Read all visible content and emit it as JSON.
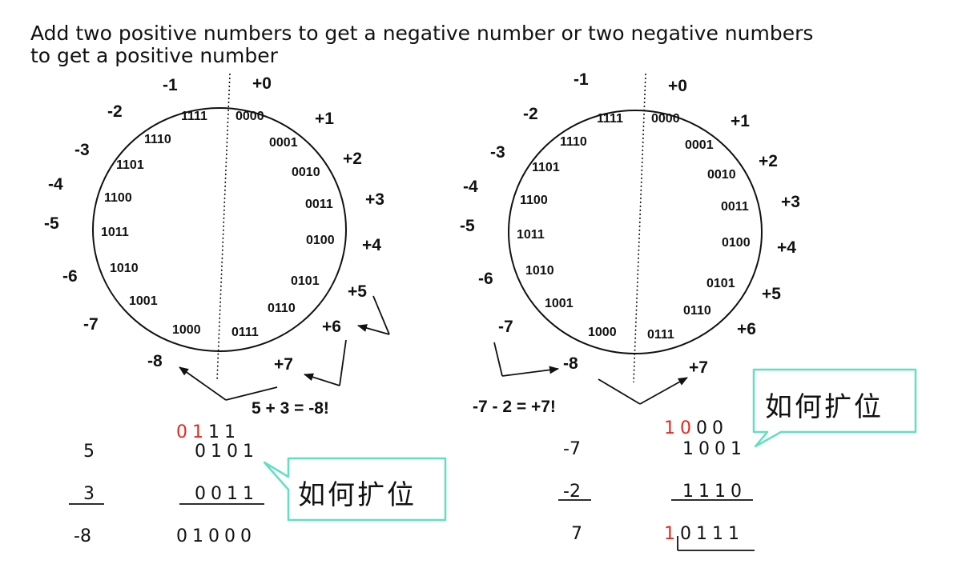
{
  "title": {
    "line1": "Add two positive numbers to get a negative number or two negative numbers",
    "line2": "to get a positive number"
  },
  "colors": {
    "carry": "#e8261d",
    "callout_border": "#5fe0c0",
    "ink": "#111111"
  },
  "left_wheel": {
    "decimals": [
      "+0",
      "+1",
      "+2",
      "+3",
      "+4",
      "+5",
      "+6",
      "+7",
      "-8",
      "-7",
      "-6",
      "-5",
      "-4",
      "-3",
      "-2",
      "-1"
    ],
    "binaries": [
      "0000",
      "0001",
      "0010",
      "0011",
      "0100",
      "0101",
      "0110",
      "0111",
      "1000",
      "1001",
      "1010",
      "1011",
      "1100",
      "1101",
      "1110",
      "1111"
    ],
    "equation": "5 + 3 = -8!"
  },
  "right_wheel": {
    "decimals": [
      "+0",
      "+1",
      "+2",
      "+3",
      "+4",
      "+5",
      "+6",
      "+7",
      "-8",
      "-7",
      "-6",
      "-5",
      "-4",
      "-3",
      "-2",
      "-1"
    ],
    "binaries": [
      "0000",
      "0001",
      "0010",
      "0011",
      "0100",
      "0101",
      "0110",
      "0111",
      "1000",
      "1001",
      "1010",
      "1011",
      "1100",
      "1101",
      "1110",
      "1111"
    ],
    "equation": "-7 - 2 = +7!"
  },
  "left_arith": {
    "carry_red": "01",
    "carry_black": "11",
    "row1_dec": "5",
    "row1_bin": "0101",
    "row2_dec": "3",
    "row2_bin": "0011",
    "result_dec": "-8",
    "result_bin": "01000"
  },
  "right_arith": {
    "carry_red": "10",
    "carry_black": "00",
    "row1_dec": "-7",
    "row1_bin": "1001",
    "row2_dec": "-2",
    "row2_bin": "1110",
    "result_dec": "7",
    "result_carry": "1",
    "result_bin": "0111"
  },
  "callouts": {
    "left": "如何扩位",
    "right": "如何扩位"
  }
}
